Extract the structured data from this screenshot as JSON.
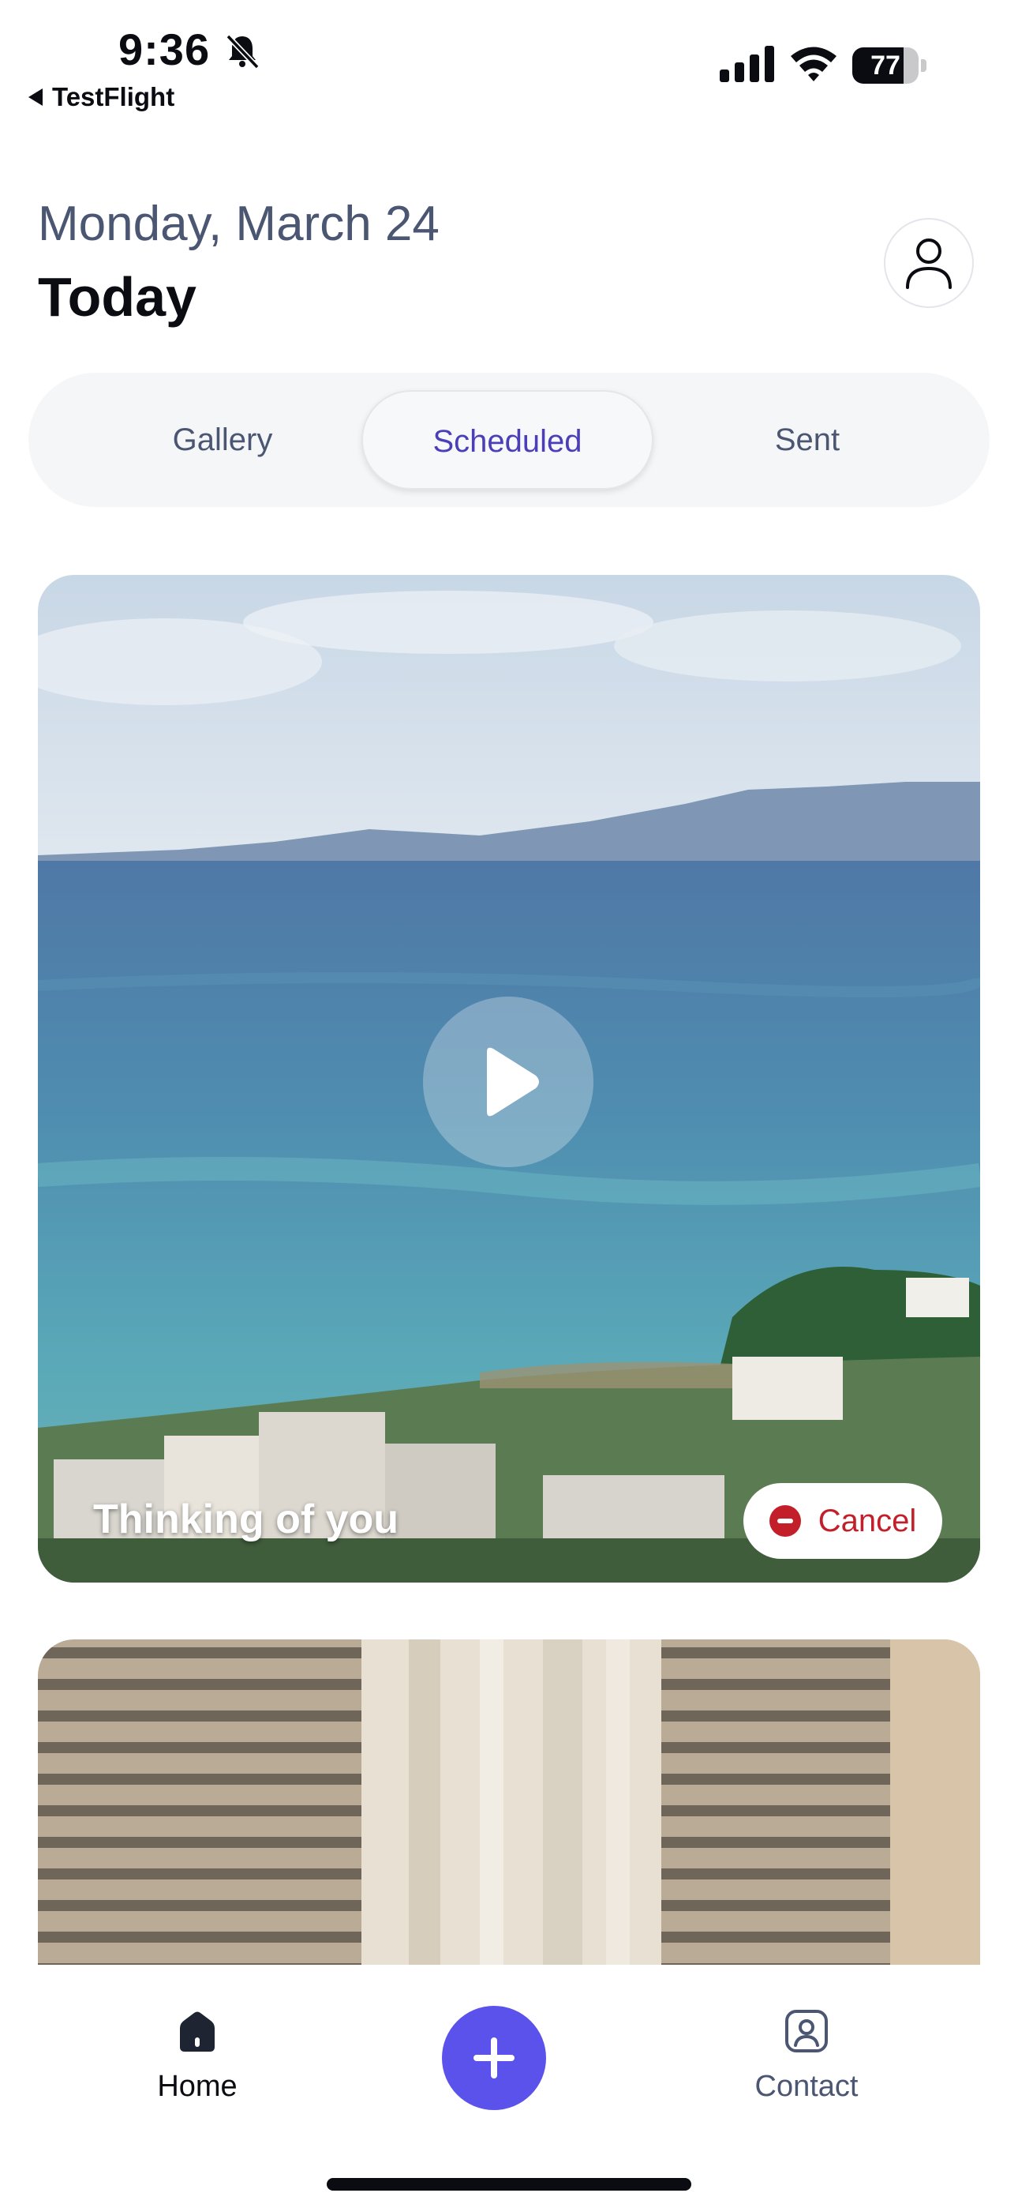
{
  "status_bar": {
    "time": "9:36",
    "back_app": "TestFlight",
    "battery_percent": "77",
    "battery_level": 0.77,
    "icons": [
      "bell-slash-icon",
      "cellular-signal-icon",
      "wifi-icon",
      "battery-icon"
    ]
  },
  "header": {
    "date": "Monday, March 24",
    "title": "Today",
    "profile_icon": "person-icon"
  },
  "tabs": [
    {
      "label": "Gallery",
      "selected": false
    },
    {
      "label": "Scheduled",
      "selected": true
    },
    {
      "label": "Sent",
      "selected": false
    }
  ],
  "cards": [
    {
      "caption": "Thinking of you",
      "cancel_label": "Cancel",
      "play_icon": "play-icon",
      "cancel_icon": "minus-circle-icon"
    },
    {
      "caption": "",
      "cancel_label": ""
    }
  ],
  "bottom_nav": {
    "home_label": "Home",
    "contact_label": "Contact",
    "home_icon": "home-icon",
    "add_icon": "plus-icon",
    "contact_icon": "contact-icon"
  },
  "colors": {
    "accent": "#5b52ec",
    "selected_tab_text": "#4a3fb8",
    "cancel_red": "#c21f2a",
    "muted_text": "#4a5672"
  }
}
